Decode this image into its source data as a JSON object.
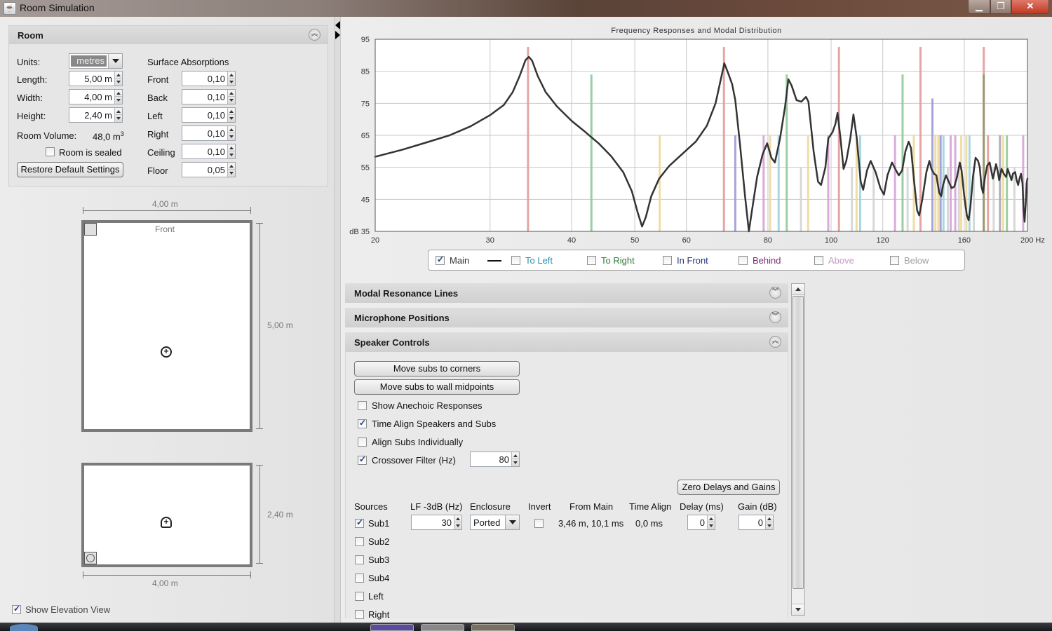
{
  "window": {
    "title": "Room Simulation",
    "icon": "java-cup-icon",
    "controls": [
      "minimize",
      "maximize",
      "close"
    ]
  },
  "room_panel": {
    "header": "Room",
    "units_label": "Units:",
    "units_value": "metres",
    "length_label": "Length:",
    "length_value": "5,00 m",
    "width_label": "Width:",
    "width_value": "4,00 m",
    "height_label": "Height:",
    "height_value": "2,40 m",
    "volume_label": "Room Volume:",
    "volume_value": "48,0 m",
    "volume_unit_sup": "3",
    "sealed_label": "Room is sealed",
    "sealed_checked": false,
    "restore_button": "Restore Default Settings",
    "absorptions_title": "Surface Absorptions",
    "absorptions": [
      {
        "label": "Front",
        "value": "0,10"
      },
      {
        "label": "Back",
        "value": "0,10"
      },
      {
        "label": "Left",
        "value": "0,10"
      },
      {
        "label": "Right",
        "value": "0,10"
      },
      {
        "label": "Ceiling",
        "value": "0,10"
      },
      {
        "label": "Floor",
        "value": "0,05"
      }
    ]
  },
  "plan_view": {
    "width_dim": "4,00 m",
    "length_dim": "5,00 m",
    "front_label": "Front"
  },
  "elevation_view": {
    "height_dim": "2,40 m",
    "width_dim": "4,00 m"
  },
  "show_elevation": {
    "label": "Show Elevation View",
    "checked": true
  },
  "chart_data": {
    "type": "line",
    "title": "Frequency Responses and Modal Distribution",
    "xlabel": "Hz",
    "ylabel": "dB",
    "x_scale": "log",
    "xlim": [
      20,
      200
    ],
    "ylim": [
      35,
      95
    ],
    "x_ticks": [
      20,
      30,
      40,
      50,
      60,
      80,
      100,
      120,
      160,
      200
    ],
    "x_tick_labels": [
      "20",
      "30",
      "40",
      "50",
      "60",
      "80",
      "100",
      "120",
      "160",
      "200 Hz"
    ],
    "y_ticks": [
      35,
      45,
      55,
      65,
      75,
      85,
      95
    ],
    "y_tick_labels": [
      "dB 35",
      "45",
      "55",
      "65",
      "75",
      "85",
      "95"
    ],
    "grid": true,
    "series": [
      {
        "name": "Main",
        "color": "#333333",
        "points": [
          [
            20,
            58.3
          ],
          [
            22,
            60.5
          ],
          [
            24,
            62.8
          ],
          [
            26,
            65.0
          ],
          [
            28,
            67.8
          ],
          [
            30,
            71.3
          ],
          [
            31.5,
            74.5
          ],
          [
            32.5,
            78.5
          ],
          [
            33.3,
            83.5
          ],
          [
            34.0,
            88.5
          ],
          [
            34.4,
            89.5
          ],
          [
            34.8,
            88.3
          ],
          [
            35.5,
            83.5
          ],
          [
            36.5,
            78.5
          ],
          [
            38,
            74.0
          ],
          [
            40,
            69.5
          ],
          [
            42,
            66.0
          ],
          [
            44,
            62.5
          ],
          [
            46,
            58.5
          ],
          [
            48,
            53.5
          ],
          [
            49.5,
            47.5
          ],
          [
            50.5,
            41.0
          ],
          [
            51.3,
            36.5
          ],
          [
            52.0,
            39.5
          ],
          [
            53,
            46.0
          ],
          [
            54.5,
            51.5
          ],
          [
            56.5,
            55.5
          ],
          [
            59,
            59.0
          ],
          [
            62,
            63.0
          ],
          [
            64.5,
            68.0
          ],
          [
            66.5,
            75.0
          ],
          [
            68.0,
            84.0
          ],
          [
            68.6,
            87.5
          ],
          [
            69.5,
            84.5
          ],
          [
            70.5,
            81.0
          ],
          [
            71.3,
            76.0
          ],
          [
            72.5,
            62.0
          ],
          [
            73.8,
            46.0
          ],
          [
            74.8,
            35.0
          ],
          [
            75.5,
            40.5
          ],
          [
            77,
            52.0
          ],
          [
            78.5,
            59.0
          ],
          [
            79.8,
            62.5
          ],
          [
            81.0,
            58.0
          ],
          [
            82.0,
            56.5
          ],
          [
            83.5,
            64.0
          ],
          [
            85.0,
            74.0
          ],
          [
            86.0,
            82.5
          ],
          [
            87.0,
            80.5
          ],
          [
            88.5,
            76.0
          ],
          [
            90.0,
            75.5
          ],
          [
            91.5,
            77.0
          ],
          [
            92.3,
            75.5
          ],
          [
            94.0,
            60.0
          ],
          [
            95.5,
            50.5
          ],
          [
            96.5,
            49.5
          ],
          [
            98.0,
            55.0
          ],
          [
            99.0,
            64.0
          ],
          [
            100.5,
            66.0
          ],
          [
            101.5,
            68.5
          ],
          [
            102.3,
            72.0
          ],
          [
            103.3,
            64.5
          ],
          [
            104.5,
            54.5
          ],
          [
            105.5,
            57.0
          ],
          [
            107,
            64.0
          ],
          [
            108.2,
            71.5
          ],
          [
            109.5,
            64.0
          ],
          [
            111,
            50.5
          ],
          [
            112,
            48.0
          ],
          [
            113.5,
            54.0
          ],
          [
            115,
            57.0
          ],
          [
            117,
            53.5
          ],
          [
            119,
            48.5
          ],
          [
            120.5,
            46.5
          ],
          [
            122,
            52.5
          ],
          [
            124,
            56.5
          ],
          [
            125.8,
            54.0
          ],
          [
            127.0,
            52.5
          ],
          [
            128.5,
            54.0
          ],
          [
            130,
            60.0
          ],
          [
            131.5,
            63.0
          ],
          [
            132.6,
            61.0
          ],
          [
            134.0,
            51.0
          ],
          [
            135.5,
            41.5
          ],
          [
            136.5,
            40.0
          ],
          [
            138.0,
            45.0
          ],
          [
            140.0,
            53.5
          ],
          [
            141.5,
            57.0
          ],
          [
            142.5,
            54.5
          ],
          [
            143.8,
            53.0
          ],
          [
            145.0,
            52.5
          ],
          [
            146.5,
            47.0
          ],
          [
            147.5,
            46.0
          ],
          [
            148.5,
            49.5
          ],
          [
            150.0,
            52.5
          ],
          [
            151.5,
            50.5
          ],
          [
            153.0,
            48.5
          ],
          [
            154.5,
            49.0
          ],
          [
            156.0,
            52.0
          ],
          [
            157.5,
            56.5
          ],
          [
            158.5,
            54.0
          ],
          [
            160.0,
            46.0
          ],
          [
            161.5,
            40.0
          ],
          [
            162.5,
            38.5
          ],
          [
            163.5,
            42.5
          ],
          [
            165.0,
            52.0
          ],
          [
            166.5,
            58.0
          ],
          [
            168.0,
            57.0
          ],
          [
            169.0,
            55.0
          ],
          [
            170.0,
            49.0
          ],
          [
            171.0,
            47.0
          ],
          [
            172.0,
            51.5
          ],
          [
            173.5,
            55.5
          ],
          [
            175.0,
            56.5
          ],
          [
            176.0,
            54.0
          ],
          [
            177.0,
            51.5
          ],
          [
            178.0,
            53.5
          ],
          [
            179.0,
            56.0
          ],
          [
            180.0,
            54.0
          ],
          [
            181.0,
            51.0
          ],
          [
            182.5,
            54.5
          ],
          [
            184.0,
            53.0
          ],
          [
            185.5,
            52.0
          ],
          [
            186.5,
            54.5
          ],
          [
            188.0,
            52.5
          ],
          [
            189.0,
            51.0
          ],
          [
            190.0,
            53.0
          ],
          [
            191.5,
            53.5
          ],
          [
            192.5,
            51.0
          ],
          [
            193.5,
            49.5
          ],
          [
            194.5,
            51.5
          ],
          [
            195.5,
            53.0
          ],
          [
            196.5,
            50.0
          ],
          [
            197.3,
            42.0
          ],
          [
            198.0,
            38.0
          ],
          [
            198.8,
            44.0
          ],
          [
            199.4,
            50.0
          ],
          [
            200,
            51.5
          ]
        ]
      }
    ],
    "modal_lines": [
      {
        "freq": 34.3,
        "level": 92.6,
        "type": "length"
      },
      {
        "freq": 42.9,
        "level": 84.0,
        "type": "width"
      },
      {
        "freq": 54.6,
        "level": 65.0,
        "type": "oblique"
      },
      {
        "freq": 68.5,
        "level": 92.6,
        "type": "length"
      },
      {
        "freq": 71.3,
        "level": 65.0,
        "type": "height"
      },
      {
        "freq": 78.8,
        "level": 65.0,
        "type": "tangential-purple"
      },
      {
        "freq": 80.6,
        "level": 65.0,
        "type": "oblique"
      },
      {
        "freq": 83.1,
        "level": 65.0,
        "type": "tangential-cyan"
      },
      {
        "freq": 85.5,
        "level": 84.0,
        "type": "width"
      },
      {
        "freq": 89.9,
        "level": 55.0,
        "type": "oblique-gray"
      },
      {
        "freq": 92.2,
        "level": 65.0,
        "type": "oblique"
      },
      {
        "freq": 99.0,
        "level": 65.0,
        "type": "tangential-purple"
      },
      {
        "freq": 102.8,
        "level": 92.6,
        "type": "length"
      },
      {
        "freq": 107.6,
        "level": 55.0,
        "type": "oblique-gray"
      },
      {
        "freq": 109.4,
        "level": 65.0,
        "type": "oblique"
      },
      {
        "freq": 110.8,
        "level": 65.0,
        "type": "tangential-cyan"
      },
      {
        "freq": 116.2,
        "level": 55.0,
        "type": "oblique-gray"
      },
      {
        "freq": 125.3,
        "level": 65.0,
        "type": "tangential-purple"
      },
      {
        "freq": 128.7,
        "level": 84.0,
        "type": "width"
      },
      {
        "freq": 131.0,
        "level": 55.0,
        "type": "oblique-gray"
      },
      {
        "freq": 133.9,
        "level": 65.0,
        "type": "oblique"
      },
      {
        "freq": 137.1,
        "level": 92.6,
        "type": "length"
      },
      {
        "freq": 143.0,
        "level": 76.5,
        "type": "height"
      },
      {
        "freq": 144.5,
        "level": 65.0,
        "type": "oblique"
      },
      {
        "freq": 146.0,
        "level": 65.0,
        "type": "oblique"
      },
      {
        "freq": 147.2,
        "level": 65.0,
        "type": "height"
      },
      {
        "freq": 148.7,
        "level": 65.0,
        "type": "tangential-cyan"
      },
      {
        "freq": 151.0,
        "level": 55.0,
        "type": "oblique-gray"
      },
      {
        "freq": 152.5,
        "level": 65.0,
        "type": "tangential-purple"
      },
      {
        "freq": 155.0,
        "level": 65.0,
        "type": "tangential-purple"
      },
      {
        "freq": 157.0,
        "level": 55.0,
        "type": "oblique-gray"
      },
      {
        "freq": 158.3,
        "level": 65.0,
        "type": "oblique"
      },
      {
        "freq": 161.2,
        "level": 65.0,
        "type": "oblique"
      },
      {
        "freq": 163.0,
        "level": 65.0,
        "type": "tangential-cyan"
      },
      {
        "freq": 165.5,
        "level": 55.0,
        "type": "oblique-gray"
      },
      {
        "freq": 171.4,
        "level": 92.6,
        "type": "length"
      },
      {
        "freq": 171.4,
        "level": 84.0,
        "type": "width-olive"
      },
      {
        "freq": 174.0,
        "level": 65.0,
        "type": "length"
      },
      {
        "freq": 177.5,
        "level": 55.0,
        "type": "oblique-gray"
      },
      {
        "freq": 181.5,
        "level": 65.0,
        "type": "height-gray"
      },
      {
        "freq": 183.5,
        "level": 65.0,
        "type": "oblique"
      },
      {
        "freq": 186.0,
        "level": 65.0,
        "type": "width"
      },
      {
        "freq": 191.0,
        "level": 55.0,
        "type": "oblique-gray"
      },
      {
        "freq": 197.0,
        "level": 65.0,
        "type": "tangential-purple"
      }
    ],
    "modal_colors": {
      "length": "#e39a9a",
      "width": "#8fc99a",
      "width-olive": "#8e9a6a",
      "height": "#9d9ad8",
      "height-gray": "#a6a6b8",
      "oblique": "#ecd99a",
      "oblique-gray": "#d4d4d4",
      "tangential-purple": "#d6a2d6",
      "tangential-cyan": "#9fd3de"
    },
    "legend": [
      {
        "label": "Main",
        "checked": true,
        "color": "#333333"
      },
      {
        "label": "To Left",
        "checked": false,
        "color": "#2b8fa6"
      },
      {
        "label": "To Right",
        "checked": false,
        "color": "#2e7a3a"
      },
      {
        "label": "In Front",
        "checked": false,
        "color": "#28357a"
      },
      {
        "label": "Behind",
        "checked": false,
        "color": "#7a2a7a"
      },
      {
        "label": "Above",
        "checked": false,
        "color": "#c89ac8"
      },
      {
        "label": "Below",
        "checked": false,
        "color": "#a0a0a0"
      }
    ],
    "legend_position": "bottom"
  },
  "accordion": [
    {
      "label": "Modal Resonance Lines",
      "expanded": false
    },
    {
      "label": "Microphone Positions",
      "expanded": false
    },
    {
      "label": "Speaker Controls",
      "expanded": true
    }
  ],
  "speaker_controls": {
    "move_corners_button": "Move subs to corners",
    "move_midpoints_button": "Move subs to wall midpoints",
    "options": [
      {
        "label": "Show Anechoic Responses",
        "checked": false
      },
      {
        "label": "Time Align Speakers and Subs",
        "checked": true
      },
      {
        "label": "Align Subs Individually",
        "checked": false
      },
      {
        "label": "Crossover Filter (Hz)",
        "checked": true
      }
    ],
    "crossover_value": "80",
    "zero_button": "Zero Delays and Gains",
    "columns": [
      "Sources",
      "LF -3dB (Hz)",
      "Enclosure",
      "Invert",
      "From Main",
      "Time Align",
      "Delay (ms)",
      "Gain (dB)"
    ],
    "sources": [
      {
        "name": "Sub1",
        "checked": true,
        "lf3db": "30",
        "enclosure": "Ported",
        "invert": false,
        "from_main": "3,46 m, 10,1 ms",
        "time_align": "0,0 ms",
        "delay": "0",
        "gain": "0"
      },
      {
        "name": "Sub2",
        "checked": false
      },
      {
        "name": "Sub3",
        "checked": false
      },
      {
        "name": "Sub4",
        "checked": false
      },
      {
        "name": "Left",
        "checked": false
      },
      {
        "name": "Right",
        "checked": false
      }
    ]
  },
  "scrollbar": {
    "position": 0.0,
    "visible_fraction": 0.92
  }
}
